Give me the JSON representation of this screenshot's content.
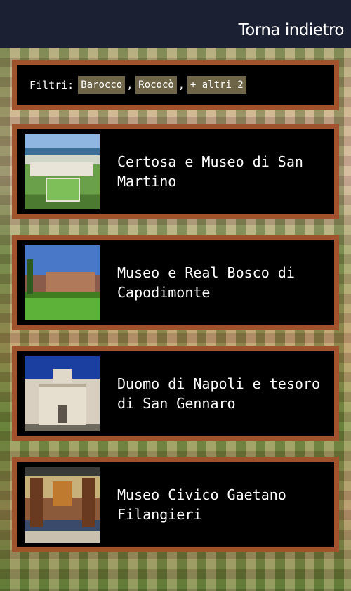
{
  "header": {
    "back_label": "Torna indietro"
  },
  "filters": {
    "label": "Filtri:",
    "chips": [
      "Barocco",
      "Rococò",
      "+ altri 2"
    ],
    "separator": ","
  },
  "places": [
    {
      "title": "Certosa e Museo di San Martino",
      "image_icon": "certosa-san-martino-photo"
    },
    {
      "title": "Museo e Real Bosco di Capodimonte",
      "image_icon": "capodimonte-photo"
    },
    {
      "title": "Duomo di Napoli e tesoro di San Gennaro",
      "image_icon": "duomo-napoli-photo"
    },
    {
      "title": "Museo Civico Gaetano Filangieri",
      "image_icon": "museo-filangieri-photo"
    }
  ],
  "colors": {
    "panel_border": "#a0522d",
    "topbar": "#1c2033",
    "chip": "#6e6548"
  }
}
